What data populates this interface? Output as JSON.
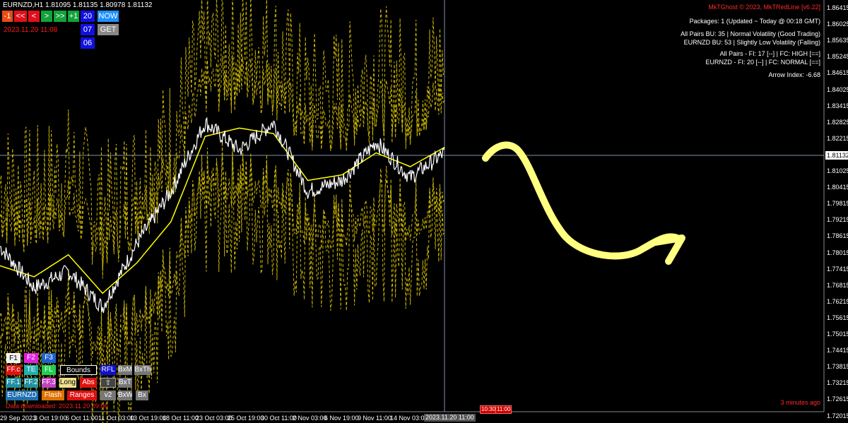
{
  "header": {
    "symbol_line": "EURNZD,H1  1.81095 1.81135 1.80978 1.81132",
    "nav_buttons": [
      "-1",
      "<<",
      "<",
      ">",
      ">>",
      "+1"
    ],
    "hour_buttons": [
      "20",
      "07",
      "06"
    ],
    "now_label": "NOW",
    "get_label": "GET",
    "date_label": "2023.11.20 11:08"
  },
  "info_panel": {
    "credit": "MkTGhost © 2023, MkTRedLine [v6.22]",
    "packages": "Packages: 1 (Updated ~ Today @ 00:18 GMT)",
    "all_pairs_bu": "All Pairs BU: 35 | Normal Volatility (Good Trading)",
    "eurnzd_bu": "EURNZD BU: 53 | Slightly Low Volatility (Falling)",
    "all_pairs_fi": "All Pairs - FI: 17 [--] | FC: HIGH  [==]",
    "eurnzd_fi": "EURNZD - FI: 20 [--] | FC: NORMAL [==]",
    "arrow_index": "Arrow Index: -6.68",
    "minutes_ago": "3 minutes ago"
  },
  "bottom_panel": {
    "row1": [
      "F1",
      "F2",
      "F3"
    ],
    "row2": [
      "FF.c",
      "TE",
      "FL",
      "Bounds",
      "RFL",
      "BxM",
      "BxTh"
    ],
    "row3": [
      "FF.1",
      "FF.2",
      "FF.3",
      "Long",
      "Abs",
      "⇧",
      "BxT"
    ],
    "row4": [
      "EURNZD",
      "Flash",
      "Ranges",
      "v2",
      "BxW",
      "Bx"
    ],
    "data_downloaded": "Data downloaded: 2023.11.20 09:06"
  },
  "price_axis": {
    "ticks": [
      "1.86415",
      "1.86025",
      "1.85635",
      "1.85245",
      "1.84615",
      "1.84025",
      "1.83415",
      "1.82825",
      "1.82215",
      "1.81625",
      "1.81025",
      "1.80415",
      "1.79815",
      "1.79215",
      "1.78615",
      "1.78015",
      "1.77415",
      "1.76815",
      "1.76215",
      "1.75615",
      "1.75015",
      "1.74415",
      "1.73815",
      "1.73215",
      "1.72615",
      "1.72015"
    ],
    "current": "1.81132"
  },
  "time_axis": {
    "labels": [
      "29 Sep 2023",
      "3 Oct 19:00",
      "6 Oct 11:00",
      "11 Oct 03:00",
      "13 Oct 19:00",
      "18 Oct 11:00",
      "23 Oct 03:00",
      "25 Oct 19:00",
      "30 Oct 11:00",
      "2 Nov 03:00",
      "6 Nov 19:00",
      "9 Nov 11:00",
      "14 Nov 03:00"
    ],
    "current": "2023.11.20 11:00",
    "stamps": [
      "10:30",
      "11:00"
    ]
  },
  "colors": {
    "price_line": "#ffffff",
    "indicator_line": "#ffff00",
    "envelope_dashed": "#c8b400",
    "crosshair": "#7f8fa6",
    "annotation": "#ffff80",
    "red_accent": "#ff1a1a"
  },
  "chart_data": {
    "type": "line",
    "symbol": "EURNZD",
    "timeframe": "H1",
    "x": [
      "29 Sep 2023",
      "3 Oct 19:00",
      "6 Oct 11:00",
      "11 Oct 03:00",
      "13 Oct 19:00",
      "18 Oct 11:00",
      "23 Oct 03:00",
      "25 Oct 19:00",
      "30 Oct 11:00",
      "2 Nov 03:00",
      "6 Nov 19:00",
      "9 Nov 11:00",
      "14 Nov 03:00",
      "2023.11.20 11:00"
    ],
    "ylim": [
      1.717,
      1.866
    ],
    "series": [
      {
        "values": [
          1.777,
          1.762,
          1.768,
          1.755,
          1.778,
          1.797,
          1.822,
          1.812,
          1.822,
          1.797,
          1.801,
          1.815,
          1.802,
          1.811
        ]
      },
      {
        "values": [
          1.77,
          1.766,
          1.774,
          1.76,
          1.771,
          1.786,
          1.817,
          1.82,
          1.818,
          1.801,
          1.803,
          1.811,
          1.806,
          1.813
        ]
      }
    ],
    "annotation": "hand-drawn yellow arrow projecting a decline then recovery"
  }
}
